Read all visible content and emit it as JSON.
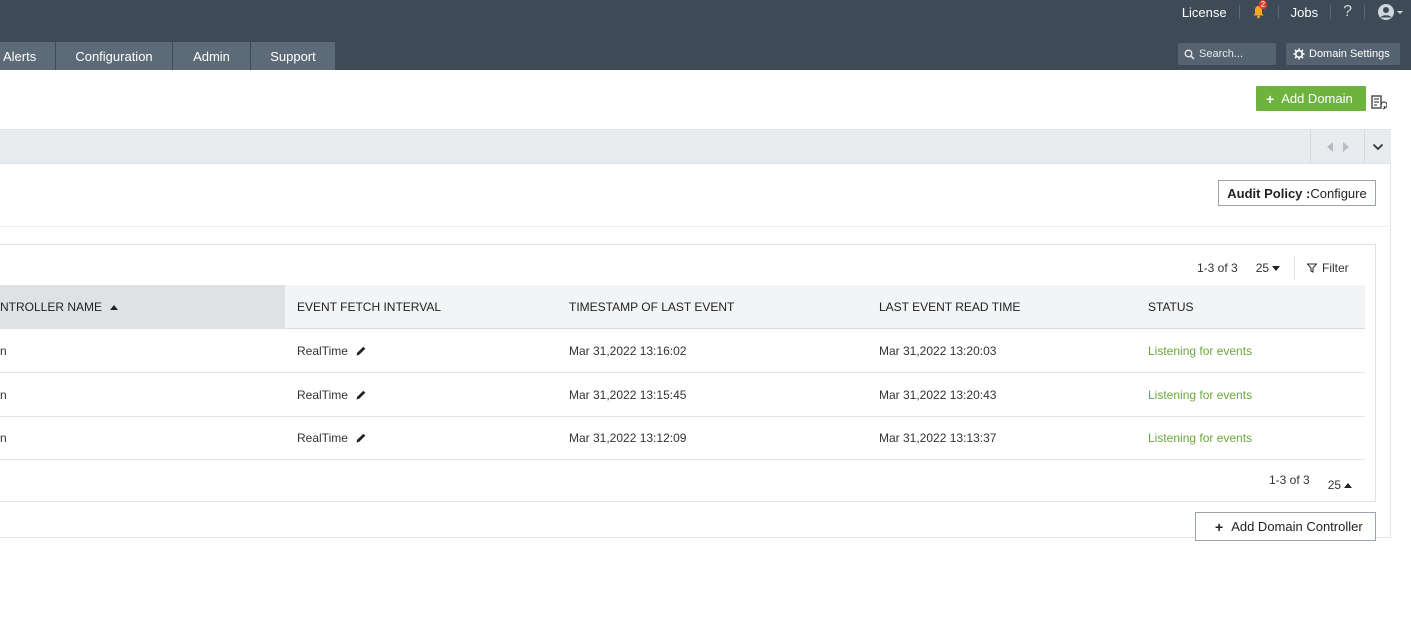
{
  "header": {
    "license": "License",
    "notifications_count": "2",
    "jobs": "Jobs",
    "help": "?",
    "user_icon": "user-circle-icon"
  },
  "nav": {
    "tabs": [
      {
        "label": "Alerts"
      },
      {
        "label": "Configuration"
      },
      {
        "label": "Admin"
      },
      {
        "label": "Support"
      }
    ]
  },
  "search": {
    "placeholder": "Search..."
  },
  "domain_settings": {
    "label": "Domain Settings"
  },
  "toolbar": {
    "add_domain_label": "Add Domain",
    "add_domain_color": "#6fb33f"
  },
  "audit_policy": {
    "bold_label": "Audit Policy :",
    "action_label": "Configure"
  },
  "grid": {
    "pager_top": {
      "range": "1-3 of 3",
      "per_page": "25"
    },
    "filter_label": "Filter",
    "columns": [
      {
        "label": "NTROLLER NAME"
      },
      {
        "label": "EVENT FETCH INTERVAL"
      },
      {
        "label": "TIMESTAMP OF LAST EVENT"
      },
      {
        "label": "LAST EVENT READ TIME"
      },
      {
        "label": "STATUS"
      }
    ],
    "rows": [
      {
        "dc": "n",
        "fetch": "RealTime",
        "timestamp": "Mar 31,2022 13:16:02",
        "read_time": "Mar 31,2022 13:20:03",
        "status": "Listening for events"
      },
      {
        "dc": "n",
        "fetch": "RealTime",
        "timestamp": "Mar 31,2022 13:15:45",
        "read_time": "Mar 31,2022 13:20:43",
        "status": "Listening for events"
      },
      {
        "dc": "n",
        "fetch": "RealTime",
        "timestamp": "Mar 31,2022 13:12:09",
        "read_time": "Mar 31,2022 13:13:37",
        "status": "Listening for events"
      }
    ],
    "pager_bottom": {
      "range": "1-3 of 3",
      "per_page": "25"
    },
    "status_color": "#6aa83a"
  },
  "add_dc": {
    "label": "Add Domain Controller"
  }
}
